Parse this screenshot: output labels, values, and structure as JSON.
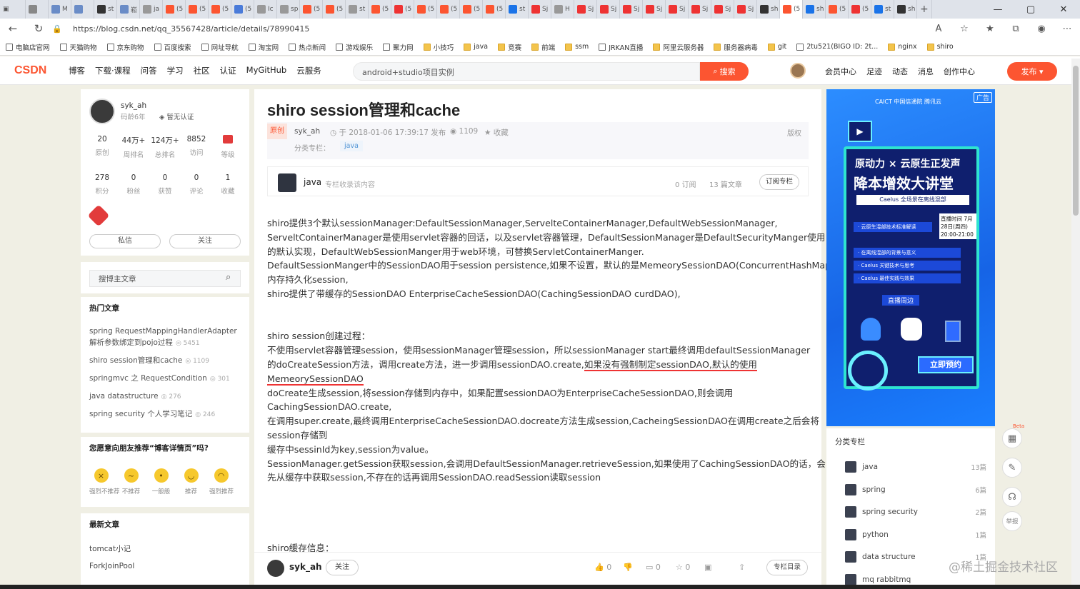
{
  "browser": {
    "tabs": [
      {
        "label": "",
        "color": "#888"
      },
      {
        "label": "M",
        "color": "#6a8cc7"
      },
      {
        "label": "",
        "color": "#6a8cc7"
      },
      {
        "label": "st",
        "color": "#333"
      },
      {
        "label": "崧",
        "color": "#6a8cc7"
      },
      {
        "label": "ja",
        "color": "#999"
      },
      {
        "label": "(5",
        "color": "#fc5531"
      },
      {
        "label": "(5",
        "color": "#fc5531"
      },
      {
        "label": "(5",
        "color": "#fc5531"
      },
      {
        "label": "(5",
        "color": "#4a7bd9"
      },
      {
        "label": "Ic",
        "color": "#999"
      },
      {
        "label": "sp",
        "color": "#999"
      },
      {
        "label": "(5",
        "color": "#fc5531"
      },
      {
        "label": "(5",
        "color": "#fc5531"
      },
      {
        "label": "st",
        "color": "#999"
      },
      {
        "label": "(5",
        "color": "#fc5531"
      },
      {
        "label": "(5",
        "color": "#e33"
      },
      {
        "label": "(5",
        "color": "#fc5531"
      },
      {
        "label": "(5",
        "color": "#fc5531"
      },
      {
        "label": "(5",
        "color": "#fc5531"
      },
      {
        "label": "(5",
        "color": "#fc5531"
      },
      {
        "label": "st",
        "color": "#1a73e8"
      },
      {
        "label": "Sj",
        "color": "#e33"
      },
      {
        "label": "H",
        "color": "#999"
      },
      {
        "label": "Sj",
        "color": "#e33"
      },
      {
        "label": "Sj",
        "color": "#e33"
      },
      {
        "label": "Sj",
        "color": "#e33"
      },
      {
        "label": "Sj",
        "color": "#e33"
      },
      {
        "label": "Sj",
        "color": "#e33"
      },
      {
        "label": "Sj",
        "color": "#e33"
      },
      {
        "label": "Sj",
        "color": "#e33"
      },
      {
        "label": "Sj",
        "color": "#e33"
      },
      {
        "label": "sh",
        "color": "#333"
      },
      {
        "label": "(5",
        "color": "#fc5531"
      },
      {
        "label": "sh",
        "color": "#1a73e8"
      },
      {
        "label": "(5",
        "color": "#fc5531"
      },
      {
        "label": "(5",
        "color": "#e33"
      },
      {
        "label": "st",
        "color": "#1a73e8"
      },
      {
        "label": "sh",
        "color": "#333"
      }
    ],
    "url": "https://blog.csdn.net/qq_35567428/article/details/78990415",
    "bookmarks": [
      {
        "label": "电脑店官网",
        "kind": "page"
      },
      {
        "label": "天猫购物",
        "kind": "page"
      },
      {
        "label": "京东购物",
        "kind": "page"
      },
      {
        "label": "百度搜索",
        "kind": "page"
      },
      {
        "label": "网址导航",
        "kind": "page"
      },
      {
        "label": "淘宝网",
        "kind": "page"
      },
      {
        "label": "热点新闻",
        "kind": "page"
      },
      {
        "label": "游戏娱乐",
        "kind": "page"
      },
      {
        "label": "聚力网",
        "kind": "page"
      },
      {
        "label": "小技巧",
        "kind": "folder"
      },
      {
        "label": "java",
        "kind": "folder"
      },
      {
        "label": "竞赛",
        "kind": "folder"
      },
      {
        "label": "前端",
        "kind": "folder"
      },
      {
        "label": "ssm",
        "kind": "folder"
      },
      {
        "label": "JRKAN直播",
        "kind": "page"
      },
      {
        "label": "阿里云服务器",
        "kind": "folder"
      },
      {
        "label": "服务器病毒",
        "kind": "folder"
      },
      {
        "label": "git",
        "kind": "folder"
      },
      {
        "label": "2tu521(BIGO ID: 2t...",
        "kind": "page"
      },
      {
        "label": "nginx",
        "kind": "folder"
      },
      {
        "label": "shiro",
        "kind": "folder"
      }
    ]
  },
  "header": {
    "logo": "CSDN",
    "nav": [
      "博客",
      "下载·课程",
      "问答",
      "学习",
      "社区",
      "认证",
      "MyGitHub",
      "云服务"
    ],
    "search_value": "android+studio项目实例",
    "search_button": "搜索",
    "right": [
      "会员中心",
      "足迹",
      "动态",
      "消息",
      "创作中心"
    ],
    "publish": "发布"
  },
  "profile": {
    "name": "syk_ah",
    "age": "码龄6年",
    "cert": "暂无认证",
    "stats1": [
      {
        "v": "20",
        "l": "原创"
      },
      {
        "v": "44万+",
        "l": "周排名"
      },
      {
        "v": "124万+",
        "l": "总排名"
      },
      {
        "v": "8852",
        "l": "访问"
      },
      {
        "v": "",
        "l": "等级"
      }
    ],
    "stats2": [
      {
        "v": "278",
        "l": "积分"
      },
      {
        "v": "0",
        "l": "粉丝"
      },
      {
        "v": "0",
        "l": "获赞"
      },
      {
        "v": "0",
        "l": "评论"
      },
      {
        "v": "1",
        "l": "收藏"
      }
    ],
    "msg_button": "私信",
    "follow_button": "关注"
  },
  "blog_search": {
    "placeholder": "搜博主文章"
  },
  "hot": {
    "title": "热门文章",
    "items": [
      {
        "title": "spring RequestMappingHandlerAdapter解析参数绑定到pojo过程",
        "views": "5451"
      },
      {
        "title": "shiro session管理和cache",
        "views": "1109"
      },
      {
        "title": "springmvc 之 RequestCondition",
        "views": "301"
      },
      {
        "title": "java datastructure",
        "views": "276"
      },
      {
        "title": "spring security 个人学习笔记",
        "views": "246"
      }
    ]
  },
  "rating": {
    "title": "您愿意向朋友推荐“博客详情页”吗?",
    "options": [
      "强烈不推荐",
      "不推荐",
      "一般般",
      "推荐",
      "强烈推荐"
    ],
    "faces": [
      "×",
      "~",
      "•",
      "◡",
      "◠"
    ]
  },
  "recent": {
    "title": "最新文章",
    "items": [
      "tomcat小记",
      "ForkJoinPool"
    ]
  },
  "article": {
    "title": "shiro session管理和cache",
    "badge": "原创",
    "author": "syk_ah",
    "time": "于 2018-01-06 17:39:17 发布",
    "views": "1109",
    "favorite": "收藏",
    "copyright": "版权",
    "category_label": "分类专栏：",
    "category": "java",
    "column": {
      "name": "java",
      "desc": "专栏收录该内容",
      "subs": "0 订阅",
      "count": "13 篇文章",
      "button": "订阅专栏"
    },
    "lines": [
      "shiro提供3个默认sessionManager:DefaultSessionManager,ServelteContainerManager,DefaultWebSessionManager,",
      "ServeltContainerManager是使用servlet容器的回话，以及servlet容器管理，DefaultSessionManager是DefaultSecurityManger使用",
      "的默认实现，DefaultWebSessionManger用于web环境，可替换ServletContainerManger.",
      "DefaultSessionManger中的SessionDAO用于session persistence,如果不设置，默认的是MemeorySessionDAO(ConcurrentHashMap),用",
      "内存持久化session,",
      "shiro提供了带缓存的SessionDAO EnterpriseCacheSessionDAO(CachingSessionDAO curdDAO),",
      "",
      "",
      "shiro session创建过程：",
      "不使用servlet容器管理session，使用sessionManager管理session，所以sessionManager start最终调用defaultSessionManager",
      "的doCreateSession方法，调用create方法，进一步调用sessionDAO.create,",
      "MemeorySessionDAO",
      "doCreate生成session,将session存储到内存中，如果配置sessionDAO为EnterpriseCacheSessionDAO,则会调用",
      "CachingSessionDAO.create,",
      "在调用super.create,最终调用EnterpriseCacheSessionDAO.docreate方法生成session,CacheingSessionDAO在调用create之后会将",
      "session存储到",
      "缓存中sessinId为key,session为value。",
      "SessionManager.getSession获取session,会调用DefaultSessionManager.retrieveSession,如果使用了CachingSessionDAO的话，会",
      "先从缓存中获取session,不存在的话再调用SessionDAO.readSession读取session",
      "",
      "",
      "",
      "",
      "shiro缓存信息："
    ],
    "underline_text": "如果没有强制制定sessionDAO,默认的使用"
  },
  "toolbar": {
    "author": "syk_ah",
    "follow": "关注",
    "likes": "0",
    "comments": "0",
    "stars": "0",
    "catalog": "专栏目录"
  },
  "ad": {
    "tag": "广告",
    "hdr": "CAICT 中国信通院  腾讯云",
    "t1": "原动力 × 云原生正发声",
    "t2": "降本增效大讲堂",
    "sub": "Caelus 全场景在离线混部",
    "rows": [
      "· 云原生混部技术标准解读",
      "· 在离线混部的背景与意义",
      "· Caelus 关键技术与思考",
      "· Caelus 最佳实践与效果"
    ],
    "date": "直播时间 7月28日(周四) 20:00-21:00",
    "live": "直播周边",
    "cta": "立即预约"
  },
  "categories": {
    "title": "分类专栏",
    "items": [
      {
        "name": "java",
        "count": "13篇"
      },
      {
        "name": "spring",
        "count": "6篇"
      },
      {
        "name": "spring security",
        "count": "2篇"
      },
      {
        "name": "python",
        "count": "1篇"
      },
      {
        "name": "data structure",
        "count": "1篇"
      },
      {
        "name": "mq rabbitmq",
        "count": ""
      }
    ]
  },
  "side_tools": {
    "beta": "Beta",
    "report": "举报"
  },
  "watermark": "@稀土掘金技术社区"
}
